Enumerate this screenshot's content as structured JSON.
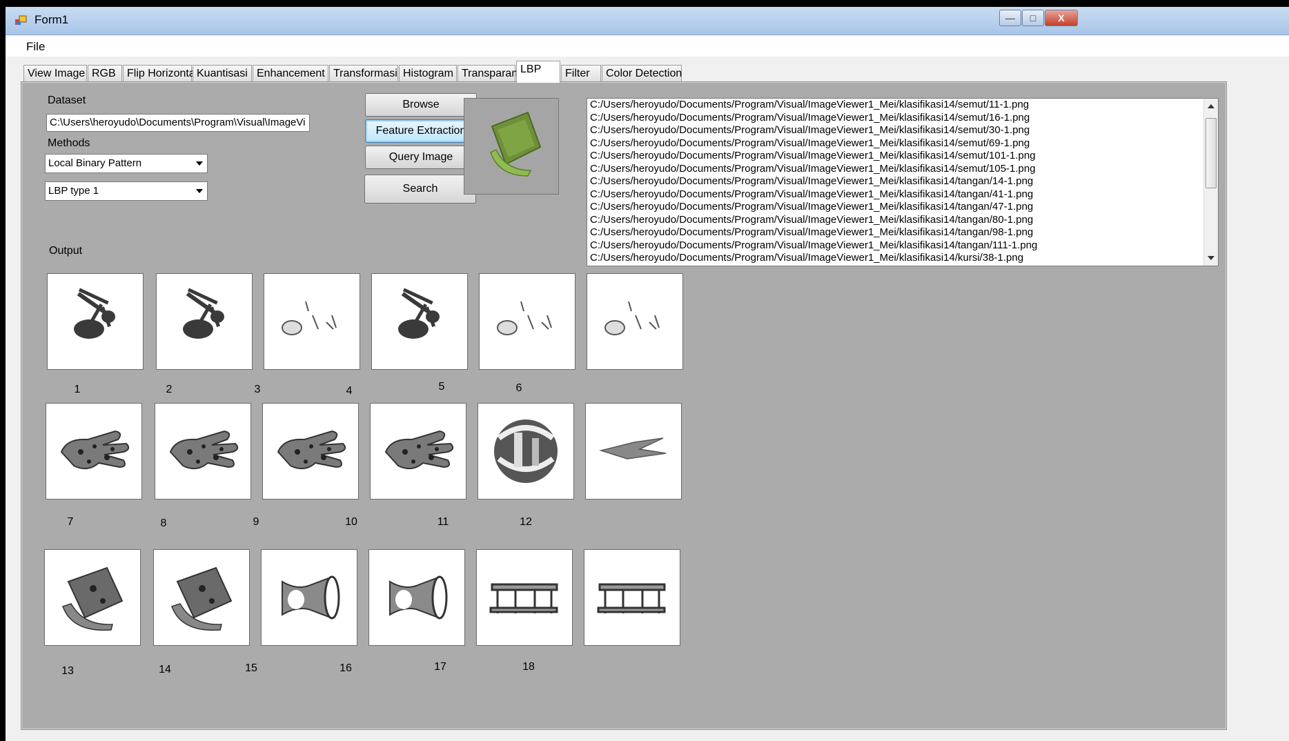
{
  "window": {
    "title": "Form1",
    "minimize": "—",
    "maximize": "□",
    "close": "X"
  },
  "menu": {
    "file": "File"
  },
  "tabs": [
    "View Image",
    "RGB",
    "Flip Horizontal",
    "Kuantisasi",
    "Enhancement",
    "Transformasi",
    "Histogram",
    "Transparan",
    "LBP",
    "Filter",
    "Color Detection"
  ],
  "active_tab": "LBP",
  "lbp": {
    "dataset_label": "Dataset",
    "dataset_value": "C:\\Users\\heroyudo\\Documents\\Program\\Visual\\ImageVi",
    "methods_label": "Methods",
    "method_value": "Local Binary Pattern",
    "type_value": "LBP type 1",
    "output_label": "Output",
    "buttons": {
      "browse": "Browse",
      "feature": "Feature Extraction",
      "query": "Query Image",
      "search": "Search"
    },
    "files": [
      "C:/Users/heroyudo/Documents/Program/Visual/ImageViewer1_Mei/klasifikasi14/semut/11-1.png",
      "C:/Users/heroyudo/Documents/Program/Visual/ImageViewer1_Mei/klasifikasi14/semut/16-1.png",
      "C:/Users/heroyudo/Documents/Program/Visual/ImageViewer1_Mei/klasifikasi14/semut/30-1.png",
      "C:/Users/heroyudo/Documents/Program/Visual/ImageViewer1_Mei/klasifikasi14/semut/69-1.png",
      "C:/Users/heroyudo/Documents/Program/Visual/ImageViewer1_Mei/klasifikasi14/semut/101-1.png",
      "C:/Users/heroyudo/Documents/Program/Visual/ImageViewer1_Mei/klasifikasi14/semut/105-1.png",
      "C:/Users/heroyudo/Documents/Program/Visual/ImageViewer1_Mei/klasifikasi14/tangan/14-1.png",
      "C:/Users/heroyudo/Documents/Program/Visual/ImageViewer1_Mei/klasifikasi14/tangan/41-1.png",
      "C:/Users/heroyudo/Documents/Program/Visual/ImageViewer1_Mei/klasifikasi14/tangan/47-1.png",
      "C:/Users/heroyudo/Documents/Program/Visual/ImageViewer1_Mei/klasifikasi14/tangan/80-1.png",
      "C:/Users/heroyudo/Documents/Program/Visual/ImageViewer1_Mei/klasifikasi14/tangan/98-1.png",
      "C:/Users/heroyudo/Documents/Program/Visual/ImageViewer1_Mei/klasifikasi14/tangan/111-1.png",
      "C:/Users/heroyudo/Documents/Program/Visual/ImageViewer1_Mei/klasifikasi14/kursi/38-1.png"
    ],
    "results": [
      {
        "num": "1",
        "kind": "ant"
      },
      {
        "num": "2",
        "kind": "ant"
      },
      {
        "num": "3",
        "kind": "ant-faint"
      },
      {
        "num": "4",
        "kind": "ant"
      },
      {
        "num": "5",
        "kind": "ant-faint"
      },
      {
        "num": "6",
        "kind": "ant-faint"
      },
      {
        "num": "7",
        "kind": "hand"
      },
      {
        "num": "8",
        "kind": "hand"
      },
      {
        "num": "9",
        "kind": "hand"
      },
      {
        "num": "10",
        "kind": "hand"
      },
      {
        "num": "11",
        "kind": "sphere"
      },
      {
        "num": "12",
        "kind": "hand-faint"
      },
      {
        "num": "13",
        "kind": "chair"
      },
      {
        "num": "14",
        "kind": "chair"
      },
      {
        "num": "15",
        "kind": "vase"
      },
      {
        "num": "16",
        "kind": "vase"
      },
      {
        "num": "17",
        "kind": "stool"
      },
      {
        "num": "18",
        "kind": "stool"
      }
    ]
  }
}
